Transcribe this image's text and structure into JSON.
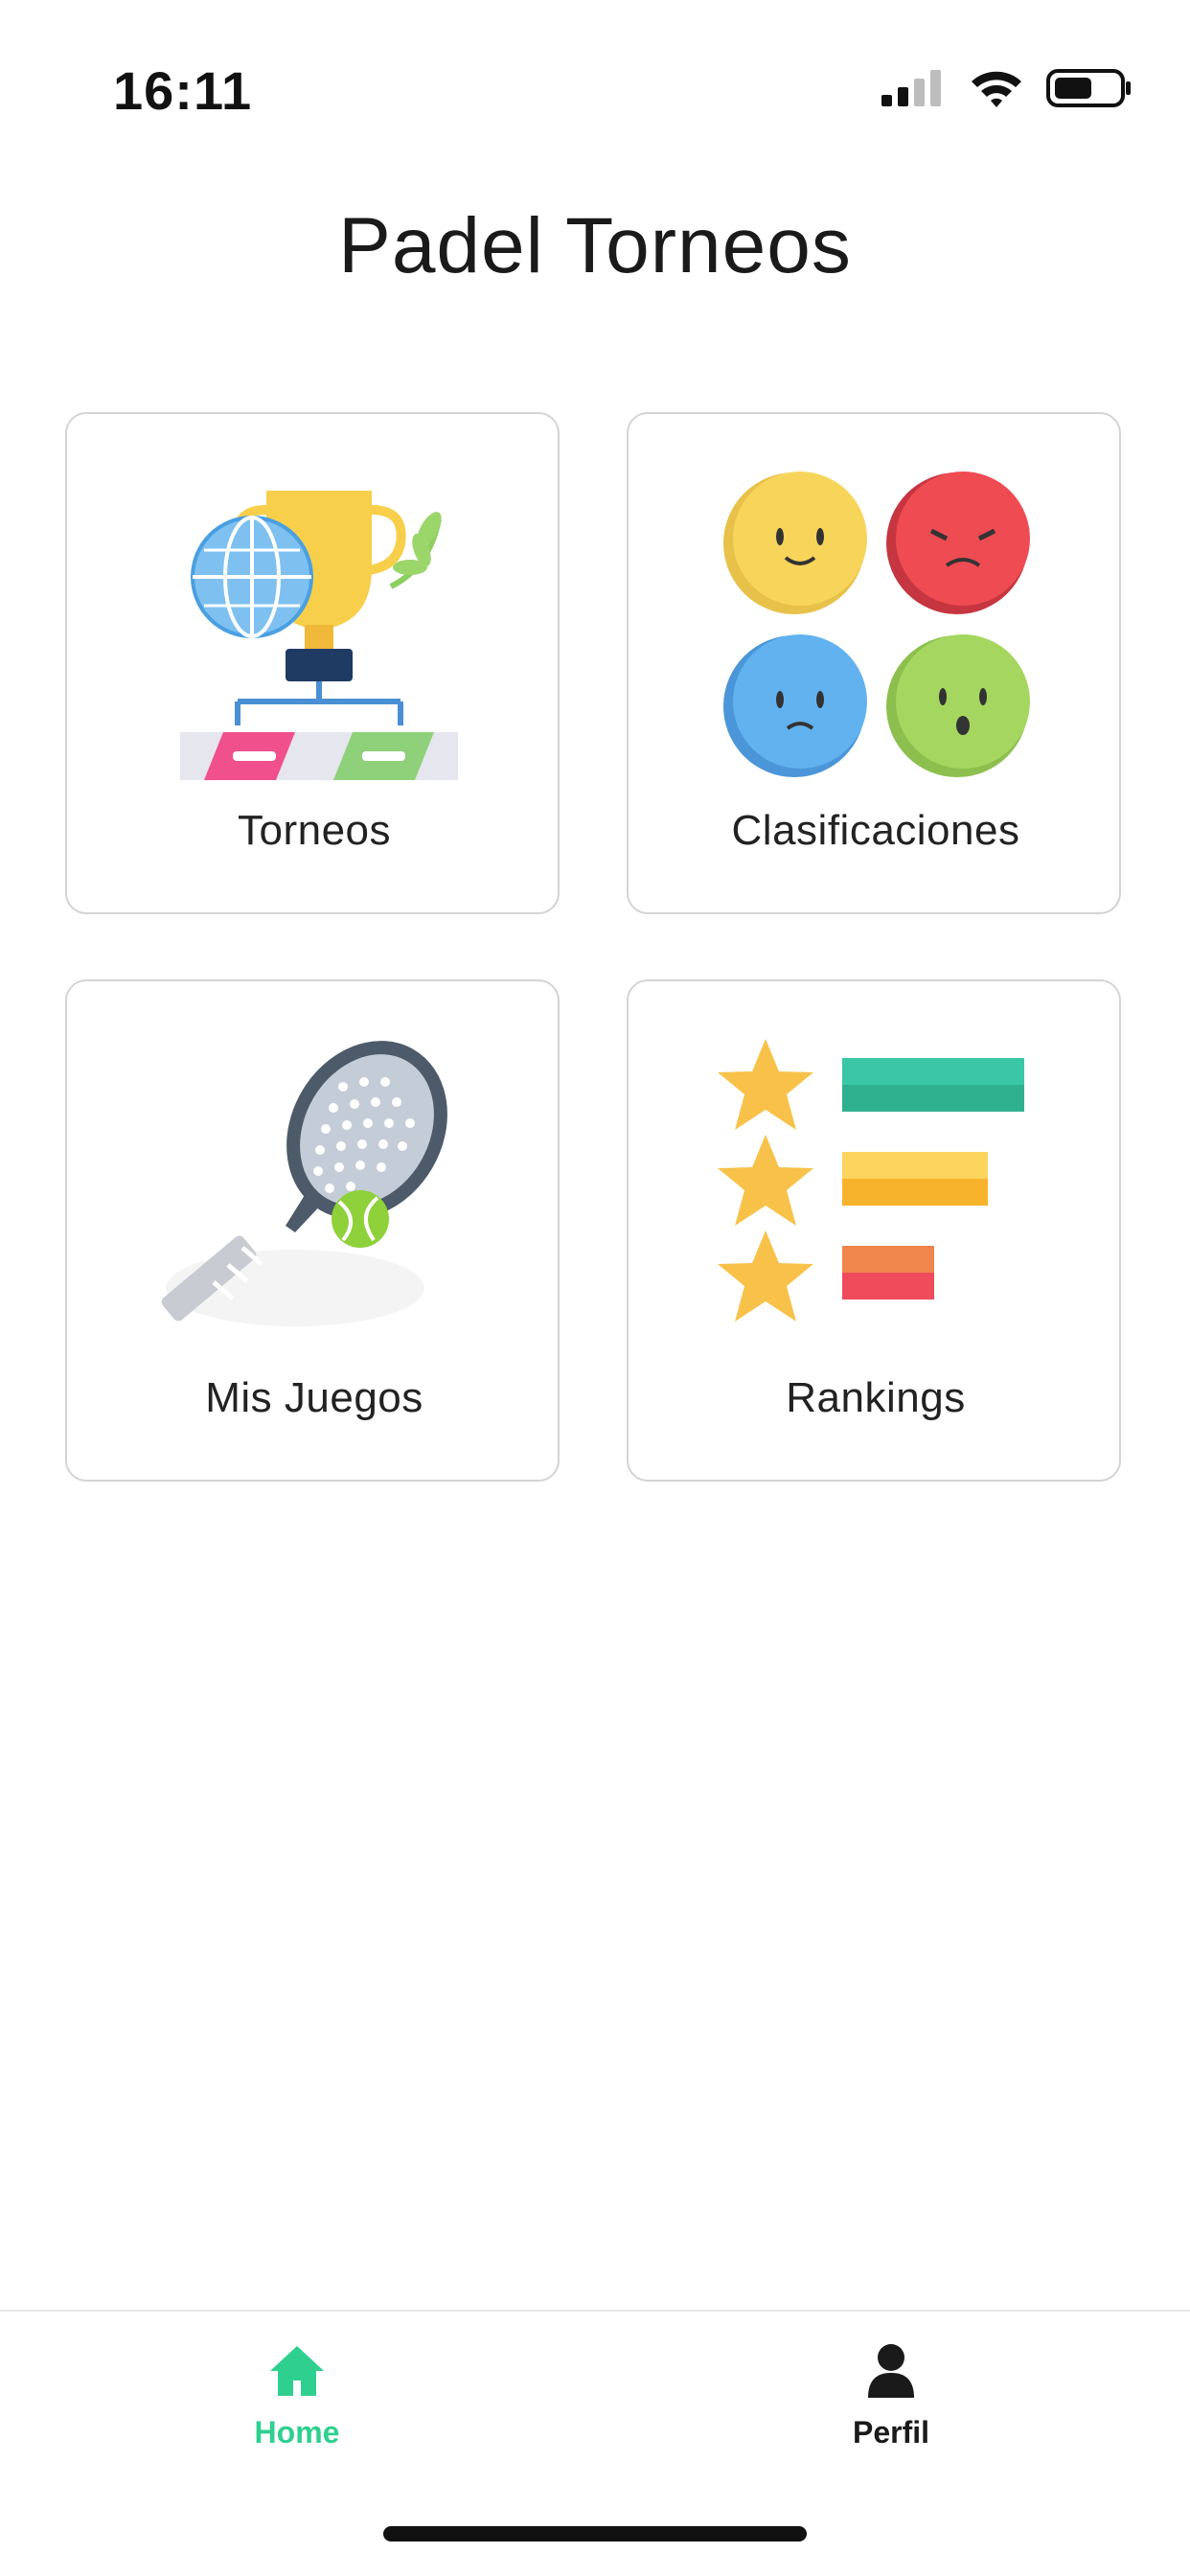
{
  "status_bar": {
    "time": "16:11",
    "icons": [
      "cellular-signal-icon",
      "wifi-icon",
      "battery-icon"
    ]
  },
  "header": {
    "title": "Padel Torneos"
  },
  "menu": {
    "cards": [
      {
        "label": "Torneos",
        "icon": "tournament-trophy-icon"
      },
      {
        "label": "Clasificaciones",
        "icon": "emoji-faces-icon"
      },
      {
        "label": "Mis Juegos",
        "icon": "padel-racket-icon"
      },
      {
        "label": "Rankings",
        "icon": "star-ranking-icon"
      }
    ]
  },
  "tab_bar": {
    "tabs": [
      {
        "label": "Home",
        "icon": "home-icon",
        "active": true
      },
      {
        "label": "Perfil",
        "icon": "user-icon",
        "active": false
      }
    ],
    "active_color": "#2fd08f",
    "inactive_color": "#1a1a1a"
  }
}
